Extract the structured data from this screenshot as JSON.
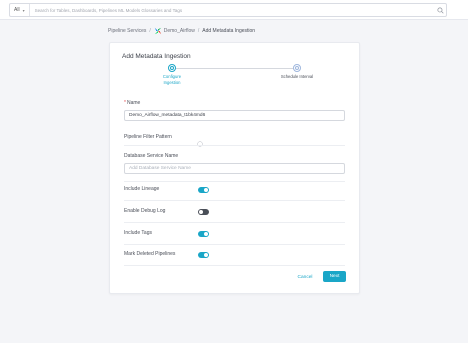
{
  "search": {
    "scope_label": "All",
    "placeholder": "Search for Tables, Dashboards, Pipelines ML Models Glossaries and Tags"
  },
  "breadcrumb": {
    "items": [
      "Pipeline Services",
      "Demo_Airflow",
      "Add Metadata Ingestion"
    ],
    "logo_icon": "airflow-logo-icon"
  },
  "form": {
    "title": "Add Metadata Ingestion",
    "steps": [
      {
        "label_line1": "Configure",
        "label_line2": "Ingestion",
        "state": "active"
      },
      {
        "label_line1": "Schedule Interval",
        "label_line2": "",
        "state": "pending"
      }
    ],
    "name": {
      "label": "Name",
      "required_mark": "*",
      "value": "Demo_Airflow_metadata_t1bk4md6"
    },
    "pipeline_filter": {
      "label": "Pipeline Filter Pattern"
    },
    "database_service": {
      "label": "Database Service Name",
      "placeholder": "Add Database Service Name"
    },
    "toggles": [
      {
        "label": "Include Lineage",
        "on": true
      },
      {
        "label": "Enable Debug Log",
        "on": false
      },
      {
        "label": "Include Tags",
        "on": true
      },
      {
        "label": "Mark Deleted Pipelines",
        "on": true
      }
    ],
    "cancel_label": "Cancel",
    "next_label": "Next"
  },
  "colors": {
    "accent": "#1aa6c7",
    "toggle_off": "#4a4f58",
    "required": "#e5484d"
  }
}
